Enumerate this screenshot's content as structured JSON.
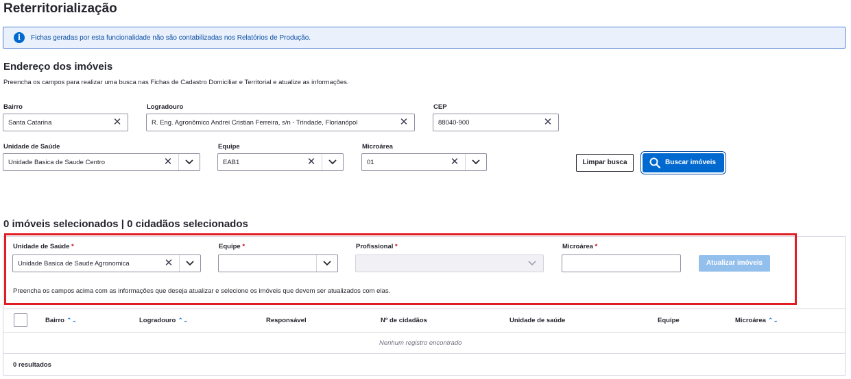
{
  "page": {
    "title": "Reterritorialização"
  },
  "alert": {
    "text": "Fichas geradas por esta funcionalidade não são contabilizadas nos Relatórios de Produção.",
    "icon": "info-icon"
  },
  "address": {
    "heading": "Endereço dos imóveis",
    "description": "Preencha os campos para realizar uma busca nas Fichas de Cadastro Domiciliar e Territorial e atualize as informações.",
    "bairro": {
      "label": "Bairro",
      "value": "Santa Catarina"
    },
    "logradouro": {
      "label": "Logradouro",
      "value": "R. Eng. Agronômico Andrei Cristian Ferreira, s/n - Trindade, Florianópol"
    },
    "cep": {
      "label": "CEP",
      "value": "88040-900"
    },
    "unidade": {
      "label": "Unidade de Saúde",
      "value": "Unidade Basica de Saude Centro"
    },
    "equipe": {
      "label": "Equipe",
      "value": "EAB1"
    },
    "microarea": {
      "label": "Microárea",
      "value": "01"
    },
    "clear_button": "Limpar busca",
    "search_button": "Buscar imóveis"
  },
  "selection": {
    "summary": "0 imóveis selecionados | 0 cidadãos selecionados",
    "required_mark": "*",
    "unidade": {
      "label": "Unidade de Saúde",
      "value": "Unidade Basica de Saude Agronomica"
    },
    "equipe": {
      "label": "Equipe",
      "value": ""
    },
    "profissional": {
      "label": "Profissional",
      "value": ""
    },
    "microarea": {
      "label": "Microárea",
      "value": ""
    },
    "update_button": "Atualizar imóveis",
    "hint": "Preencha os campos acima com as informações que deseja atualizar e selecione os imóveis que devem ser atualizados com elas."
  },
  "table": {
    "columns": [
      "Bairro",
      "Logradouro",
      "Responsável",
      "Nº de cidadãos",
      "Unidade de saúde",
      "Equipe",
      "Microárea"
    ],
    "empty_text": "Nenhum registro encontrado",
    "results": "0 resultados"
  },
  "colors": {
    "primary": "#0069d0",
    "highlight": "#e01c24",
    "required": "#d0021b"
  }
}
